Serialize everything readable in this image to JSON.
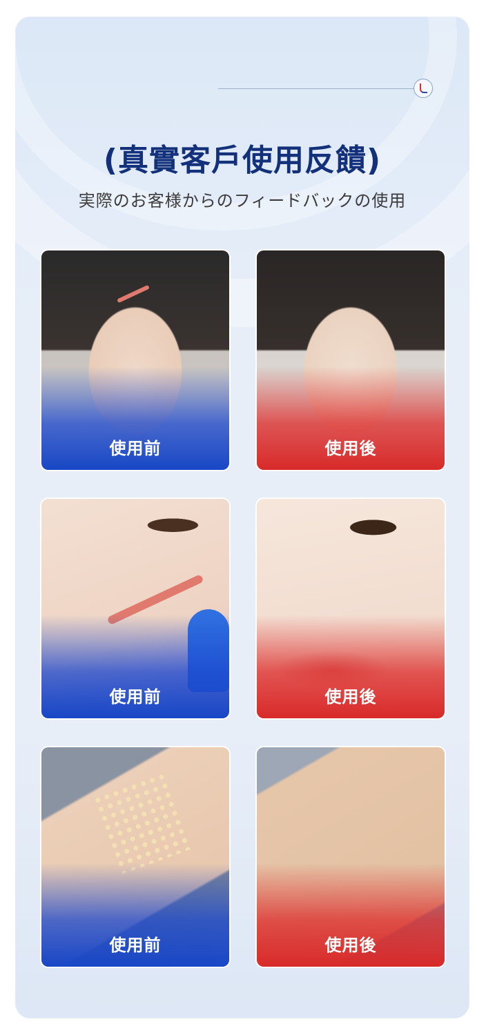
{
  "header": {
    "title": "(真實客戶使用反饋)",
    "subtitle": "実際のお客様からのフィードバックの使用"
  },
  "comparisons": [
    {
      "before_label": "使用前",
      "after_label": "使用後",
      "subject": "face"
    },
    {
      "before_label": "使用前",
      "after_label": "使用後",
      "subject": "cheek"
    },
    {
      "before_label": "使用前",
      "after_label": "使用後",
      "subject": "arm"
    }
  ],
  "colors": {
    "title": "#13307a",
    "before_accent": "#1847c6",
    "after_accent": "#d82a2a"
  }
}
